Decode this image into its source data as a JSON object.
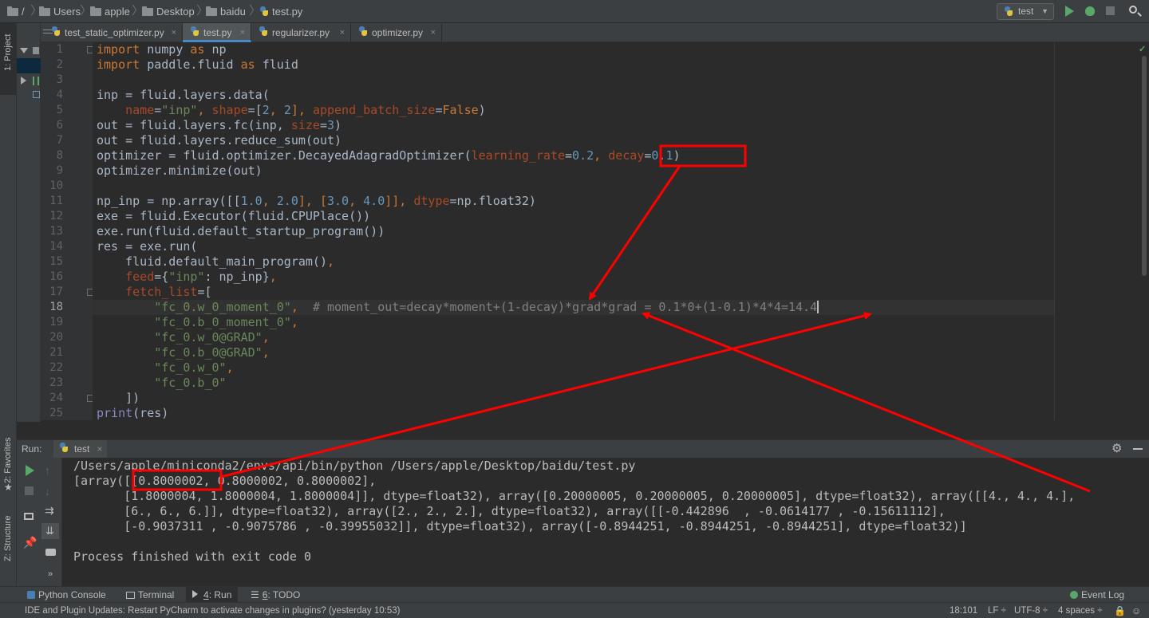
{
  "breadcrumbs": [
    "/",
    "Users",
    "apple",
    "Desktop",
    "baidu",
    "test.py"
  ],
  "run_config": {
    "label": "test"
  },
  "side_tabs": {
    "project": "1: Project",
    "favorites": "2: Favorites",
    "structure": "Z: Structure"
  },
  "editor_tabs": [
    {
      "label": "test_static_optimizer.py",
      "close": "×"
    },
    {
      "label": "test.py",
      "close": "×"
    },
    {
      "label": "regularizer.py",
      "close": "×"
    },
    {
      "label": "optimizer.py",
      "close": "×"
    }
  ],
  "line_numbers": [
    "1",
    "2",
    "3",
    "4",
    "5",
    "6",
    "7",
    "8",
    "9",
    "10",
    "11",
    "12",
    "13",
    "14",
    "15",
    "16",
    "17",
    "18",
    "19",
    "20",
    "21",
    "22",
    "23",
    "24",
    "25"
  ],
  "code": {
    "l1": {
      "k1": "import",
      "t1": " numpy ",
      "k2": "as",
      "t2": " np"
    },
    "l2": {
      "k1": "import",
      "t1": " paddle.fluid ",
      "k2": "as",
      "t2": " fluid"
    },
    "l4": {
      "t1": "inp = fluid.layers.data("
    },
    "l5": {
      "ind": "    ",
      "p1": "name",
      "e1": "=",
      "s1": "\"inp\"",
      "c1": ", ",
      "p2": "shape",
      "e2": "=[",
      "n1": "2",
      "c2": ", ",
      "n2": "2",
      "k1": "], ",
      "p3": "append_batch_size",
      "e3": "=",
      "k2": "False",
      "t2": ")"
    },
    "l6": {
      "t1": "out = fluid.layers.fc(inp, ",
      "p1": "size",
      "e1": "=",
      "n1": "3",
      "t2": ")"
    },
    "l7": {
      "t1": "out = fluid.layers.reduce_sum(out)"
    },
    "l8": {
      "t1": "optimizer = fluid.optimizer.DecayedAdagradOptimizer(",
      "p1": "learning_rate",
      "e1": "=",
      "n1": "0.2",
      "c1": ", ",
      "p2": "decay",
      "e2": "=",
      "n2": "0.1",
      "t2": ")"
    },
    "l9": {
      "t1": "optimizer.minimize(out)"
    },
    "l11": {
      "t1": "np_inp = np.array([[",
      "n1": "1.0",
      "c1": ", ",
      "n2": "2.0",
      "c2": "], [",
      "n3": "3.0",
      "c3": ", ",
      "n4": "4.0",
      "c4": "]], ",
      "p1": "dtype",
      "t2": "=np.float32)"
    },
    "l12": {
      "t1": "exe = fluid.Executor(fluid.CPUPlace())"
    },
    "l13": {
      "t1": "exe.run(fluid.default_startup_program())"
    },
    "l14": {
      "t1": "res = exe.run("
    },
    "l15": {
      "ind": "    ",
      "t1": "fluid.default_main_program()",
      "c1": ","
    },
    "l16": {
      "ind": "    ",
      "p1": "feed",
      "t1": "={",
      "s1": "\"inp\"",
      "t2": ": np_inp}",
      "c1": ","
    },
    "l17": {
      "ind": "    ",
      "p1": "fetch_list",
      "t1": "=["
    },
    "l18": {
      "ind": "        ",
      "s1": "\"fc_0.w_0_moment_0\"",
      "c1": ",",
      "gap": "  ",
      "cm": "# moment_out=decay*moment+(1-decay)*grad*grad = 0.1*0+(1-0.1)*4*4=14.4"
    },
    "l19": {
      "ind": "        ",
      "s1": "\"fc_0.b_0_moment_0\"",
      "c1": ","
    },
    "l20": {
      "ind": "        ",
      "s1": "\"fc_0.w_0@GRAD\"",
      "c1": ","
    },
    "l21": {
      "ind": "        ",
      "s1": "\"fc_0.b_0@GRAD\"",
      "c1": ","
    },
    "l22": {
      "ind": "        ",
      "s1": "\"fc_0.w_0\"",
      "c1": ","
    },
    "l23": {
      "ind": "        ",
      "s1": "\"fc_0.b_0\""
    },
    "l24": {
      "ind": "    ",
      "t1": "])"
    },
    "l25": {
      "b1": "print",
      "t1": "(res)"
    }
  },
  "run_panel": {
    "title": "Run:",
    "tab_label": "test",
    "tab_close": "×",
    "output_lines": [
      "/Users/apple/miniconda2/envs/api/bin/python /Users/apple/Desktop/baidu/test.py",
      "[array([[0.8000002, 0.8000002, 0.8000002],",
      "       [1.8000004, 1.8000004, 1.8000004]], dtype=float32), array([0.20000005, 0.20000005, 0.20000005], dtype=float32), array([[4., 4., 4.],",
      "       [6., 6., 6.]], dtype=float32), array([2., 2., 2.], dtype=float32), array([[-0.442896  , -0.0614177 , -0.15611112],",
      "       [-0.9037311 , -0.9075786 , -0.39955032]], dtype=float32), array([-0.8944251, -0.8944251, -0.8944251], dtype=float32)]",
      "",
      "Process finished with exit code 0"
    ]
  },
  "bottom_tabs": {
    "python_console": "Python Console",
    "terminal": "Terminal",
    "run_num": "4",
    "run_rest": ": Run",
    "todo_num": "6",
    "todo_rest": ": TODO",
    "event_log": "Event Log"
  },
  "status_bar": {
    "message": "IDE and Plugin Updates: Restart PyCharm to activate changes in plugins? (yesterday 10:53)",
    "position": "18:101",
    "line_sep": "LF ÷",
    "encoding": "UTF-8 ÷",
    "indent": "4 spaces ÷"
  },
  "colors": {
    "annotation_red": "#ff0000",
    "run_green": "#59a869",
    "keyword": "#cc7832",
    "string": "#6a8759",
    "number": "#6897bb",
    "param": "#aa4926",
    "comment": "#808080"
  }
}
